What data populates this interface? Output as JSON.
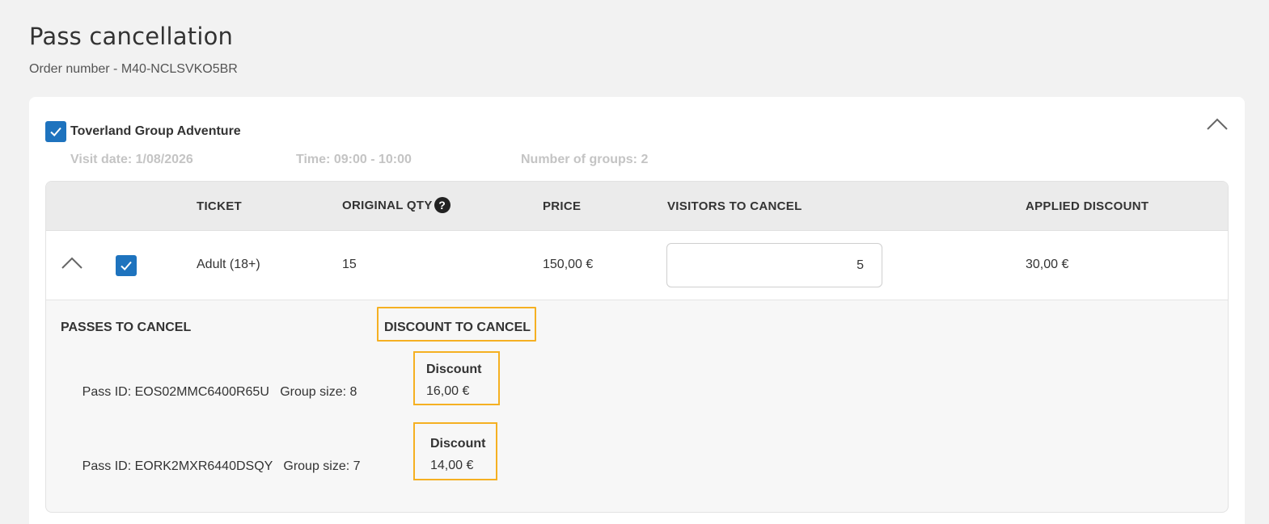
{
  "page": {
    "title": "Pass cancellation",
    "order_number": "Order number - M40-NCLSVKO5BR"
  },
  "product": {
    "name": "Toverland Group Adventure",
    "checked": true,
    "visit_date": "Visit date: 1/08/2026",
    "time": "Time: 09:00 - 10:00",
    "groups": "Number of groups: 2"
  },
  "table": {
    "headers": {
      "ticket": "TICKET",
      "original_qty": "ORIGINAL QTY",
      "price": "PRICE",
      "visitors_to_cancel": "VISITORS TO CANCEL",
      "applied_discount": "APPLIED DISCOUNT"
    },
    "help_glyph": "?",
    "row": {
      "ticket": "Adult (18+)",
      "original_qty": "15",
      "price": "150,00 €",
      "visitors_to_cancel": "5",
      "applied_discount": "30,00 €",
      "checked": true
    }
  },
  "details": {
    "passes_heading": "PASSES TO CANCEL",
    "discount_heading": "DISCOUNT TO CANCEL",
    "passes": [
      {
        "pass_id": "Pass ID: EOS02MMC6400R65U",
        "group_size": "Group size: 8",
        "discount_label": "Discount",
        "discount_value": "16,00 €"
      },
      {
        "pass_id": "Pass ID: EORK2MXR6440DSQY",
        "group_size": "Group size: 7",
        "discount_label": "Discount",
        "discount_value": "14,00 €"
      }
    ]
  },
  "colors": {
    "accent": "#1e73be",
    "highlight": "#f5b022",
    "background": "#f2f2f2"
  }
}
